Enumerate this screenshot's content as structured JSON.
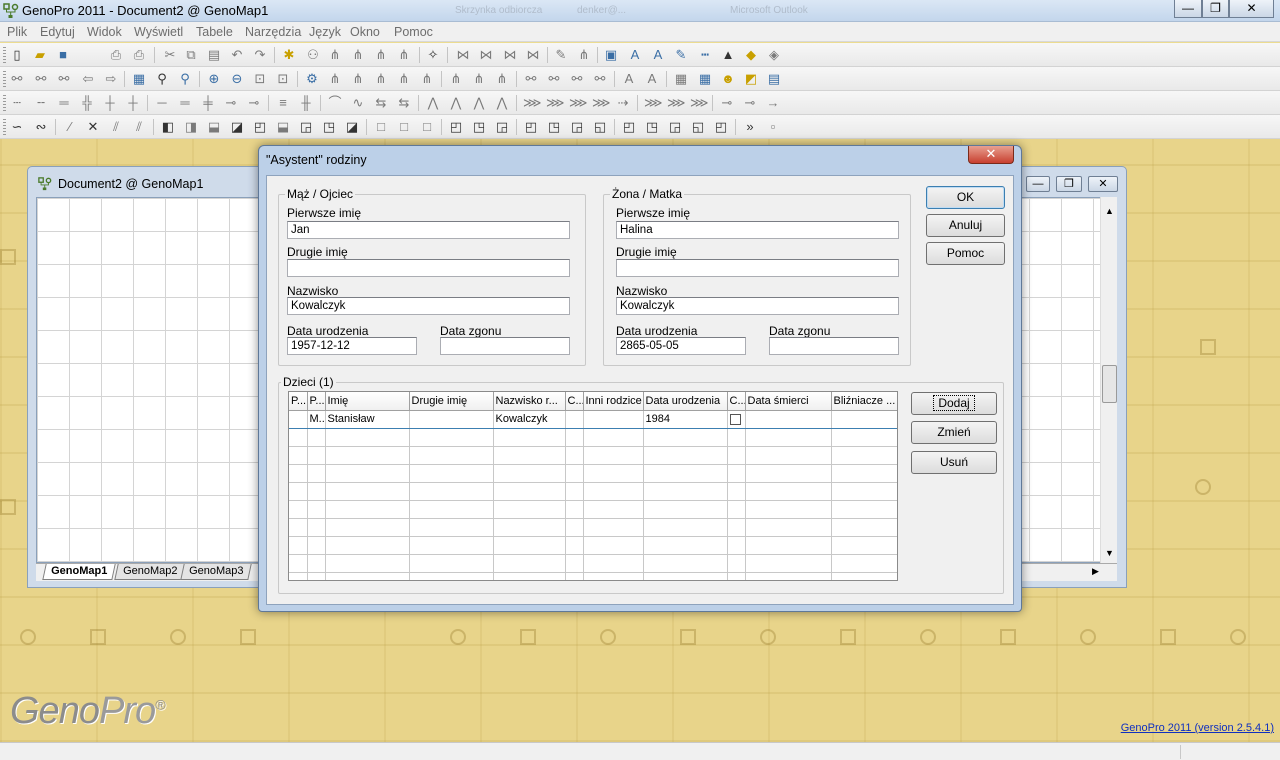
{
  "app": {
    "title": "GenoPro 2011 - Document2 @ GenoMap1",
    "blurred_titles": [
      "Skrzynka odbiorcza",
      "denker@...",
      "Microsoft Outlook"
    ]
  },
  "window_controls": {
    "minimize": "—",
    "restore": "❐",
    "close": "✕"
  },
  "menu": [
    "Plik",
    "Edytuj",
    "Widok",
    "Wyświetl",
    "Tabele",
    "Narzędzia",
    "Język",
    "Okno",
    "Pomoc"
  ],
  "document": {
    "title": "Document2 @ GenoMap1",
    "tabs": [
      "GenoMap1",
      "GenoMap2",
      "GenoMap3"
    ],
    "active_tab": "GenoMap1"
  },
  "dialog": {
    "title": "\"Asystent\" rodziny",
    "close": "✕",
    "father": {
      "group_label": "Mąż / Ojciec",
      "first_name_label": "Pierwsze imię",
      "first_name": "Jan",
      "middle_name_label": "Drugie imię",
      "middle_name": "",
      "last_name_label": "Nazwisko",
      "last_name": "Kowalczyk",
      "birth_label": "Data urodzenia",
      "birth": "1957-12-12",
      "death_label": "Data zgonu",
      "death": ""
    },
    "mother": {
      "group_label": "Żona / Matka",
      "first_name_label": "Pierwsze imię",
      "first_name": "Halina",
      "middle_name_label": "Drugie imię",
      "middle_name": "",
      "last_name_label": "Nazwisko",
      "last_name": "Kowalczyk",
      "birth_label": "Data urodzenia",
      "birth": "2865-05-05",
      "death_label": "Data zgonu",
      "death": ""
    },
    "buttons": {
      "ok": "OK",
      "cancel": "Anuluj",
      "help": "Pomoc",
      "add": "Dodaj",
      "edit": "Zmień",
      "remove": "Usuń"
    },
    "children": {
      "group_label": "Dzieci (1)",
      "columns": [
        "P...",
        "P...",
        "Imię",
        "Drugie imię",
        "Nazwisko r...",
        "C...",
        "Inni rodzice",
        "Data urodzenia",
        "C...",
        "Data śmierci",
        "Bliźniacze ..."
      ],
      "rows": [
        [
          "",
          "M...",
          "Stanisław",
          "",
          "Kowalczyk",
          "",
          "",
          "1984",
          "",
          "",
          ""
        ]
      ]
    }
  },
  "footer": {
    "logo_main": "Geno",
    "logo_pro": "Pro",
    "logo_mark": "®",
    "version_link": "GenoPro 2011 (version 2.5.4.1)"
  }
}
